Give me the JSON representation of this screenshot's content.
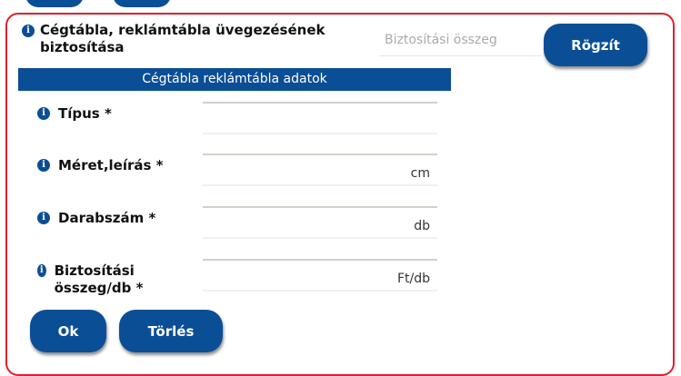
{
  "form": {
    "title": "Cégtábla, reklámtábla üvegezésének biztosítása",
    "insurance_placeholder": "Biztosítási összeg",
    "record_button": "Rögzít",
    "section_header": "Cégtábla reklámtábla adatok"
  },
  "fields": [
    {
      "label": "Típus *",
      "unit": ""
    },
    {
      "label": "Méret,leírás *",
      "unit": "cm"
    },
    {
      "label": "Darabszám *",
      "unit": "db"
    },
    {
      "label": "Biztosítási összeg/db *",
      "unit": "Ft/db"
    }
  ],
  "buttons": {
    "ok": "Ok",
    "delete": "Törlés"
  },
  "icons": {
    "info": "i"
  },
  "colors": {
    "primary": "#0a4e96",
    "border": "#e01e2d"
  }
}
